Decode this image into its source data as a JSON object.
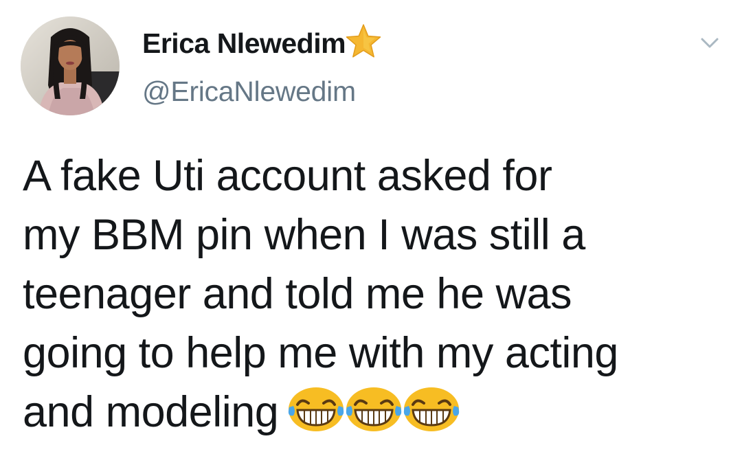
{
  "tweet": {
    "author": {
      "display_name": "Erica Nlewedim",
      "handle": "@EricaNlewedim",
      "avatar_icon": "profile-photo",
      "badge_icon": "star-icon",
      "badge_color": "#f5b731"
    },
    "menu_icon": "chevron-down-icon",
    "text_lines": [
      "A fake Uti account asked for",
      "my BBM pin when I was still a",
      "teenager and told me he was",
      "going to help me with my acting",
      "and modeling"
    ],
    "emojis": [
      "face-with-tears-of-joy",
      "face-with-tears-of-joy",
      "face-with-tears-of-joy"
    ],
    "colors": {
      "text": "#14171a",
      "secondary": "#657786",
      "emoji_face": "#f7bd23"
    }
  }
}
